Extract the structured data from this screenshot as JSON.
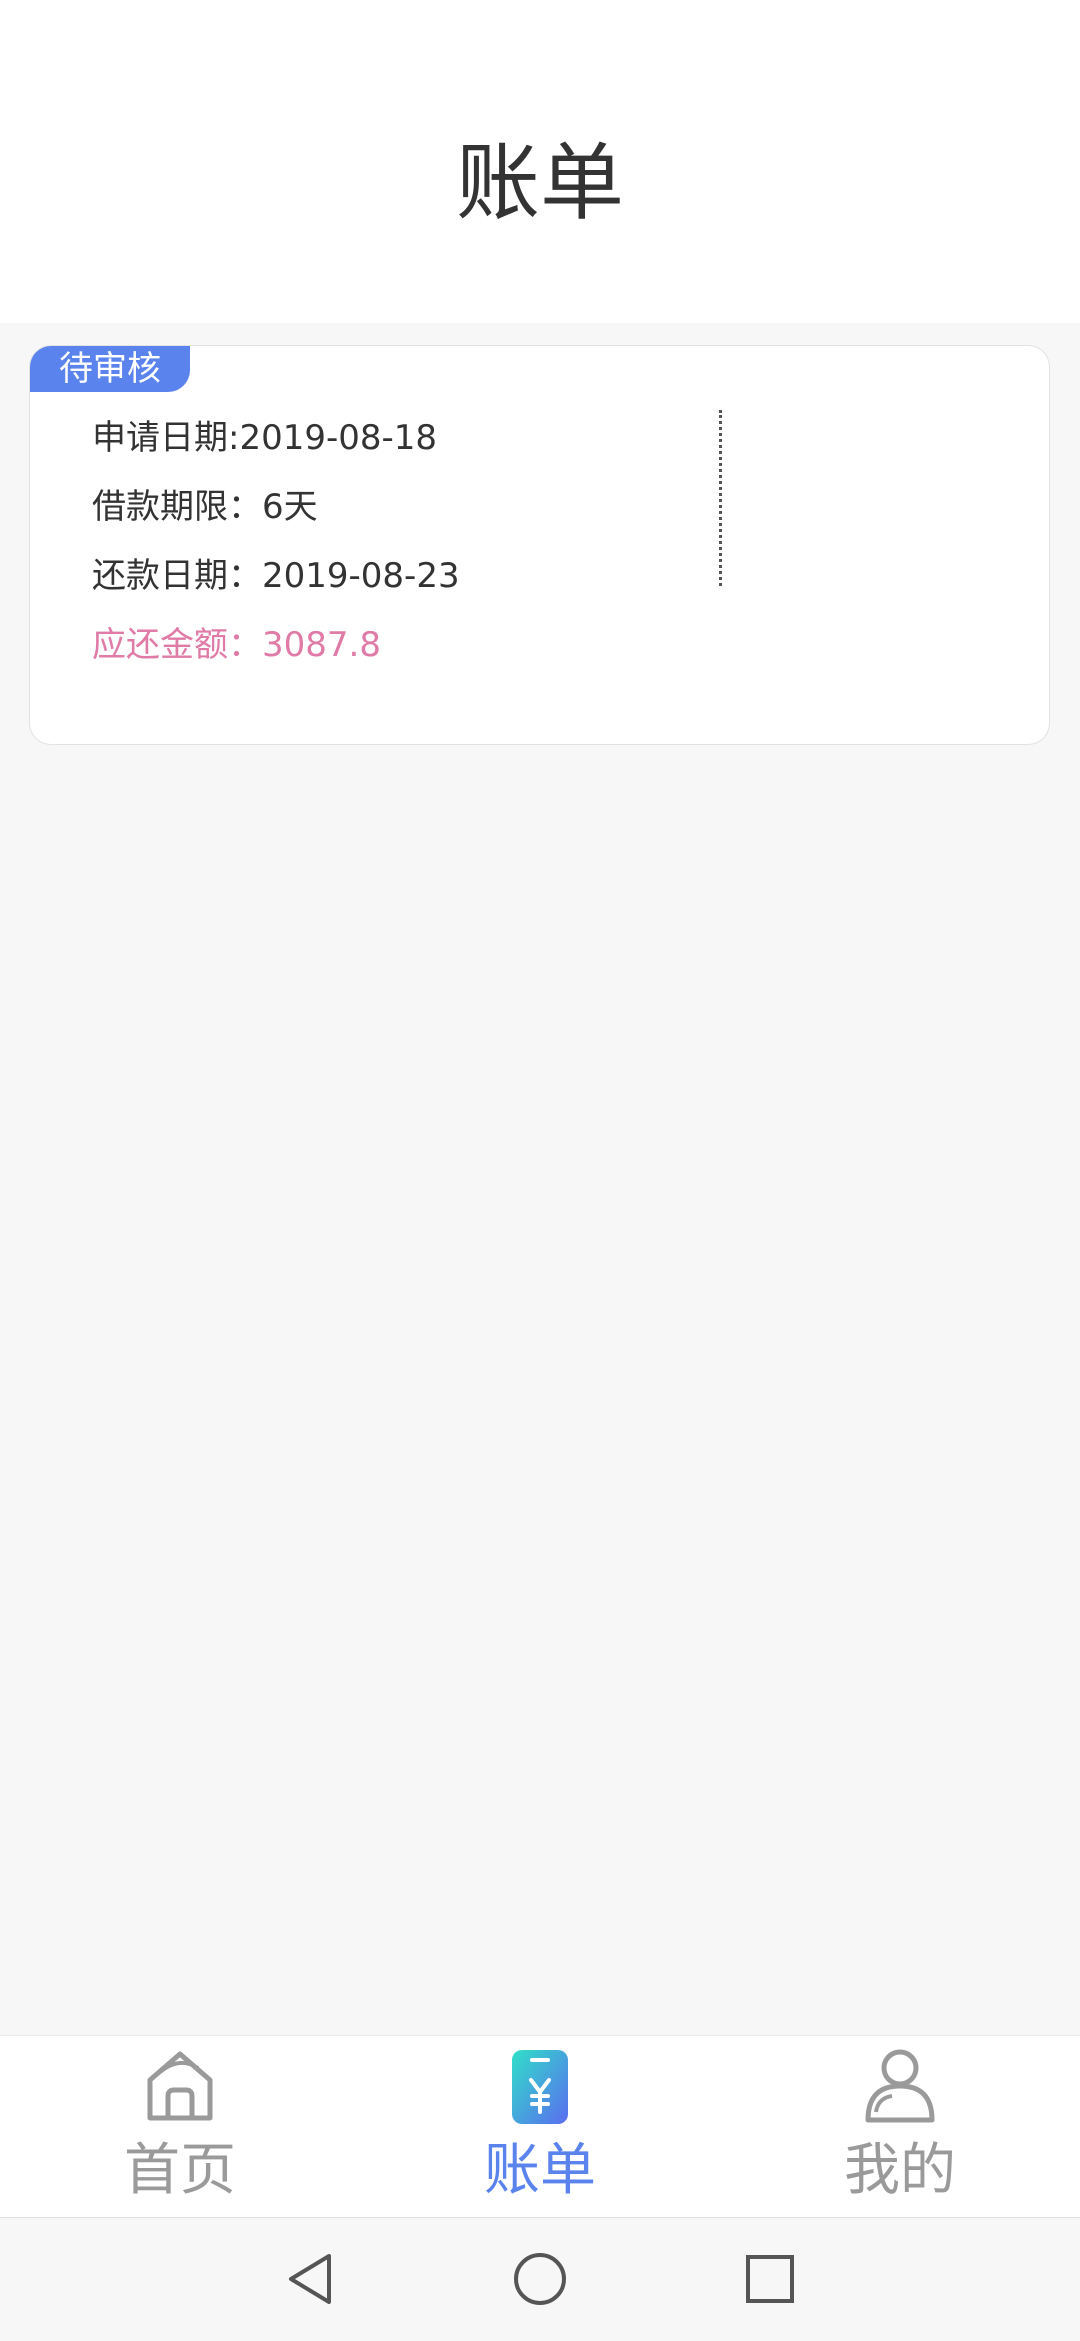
{
  "header": {
    "title": "账单"
  },
  "bill": {
    "status": "待审核",
    "apply_date": "申请日期:2019-08-18",
    "term": "借款期限：6天",
    "repay_date": "还款日期：2019-08-23",
    "amount_due": "应还金额：3087.8",
    "colors": {
      "badge": "#5b83ee",
      "amount": "#e07aa6"
    }
  },
  "tabbar": {
    "items": [
      {
        "label": "首页",
        "icon": "home-icon",
        "active": false
      },
      {
        "label": "账单",
        "icon": "bill-yuan-icon",
        "active": true
      },
      {
        "label": "我的",
        "icon": "user-icon",
        "active": false
      }
    ],
    "active_color": "#5b83ee",
    "inactive_color": "#9a9a9a"
  },
  "system_nav": {
    "buttons": [
      "back-icon",
      "home-circle-icon",
      "recents-icon"
    ]
  }
}
